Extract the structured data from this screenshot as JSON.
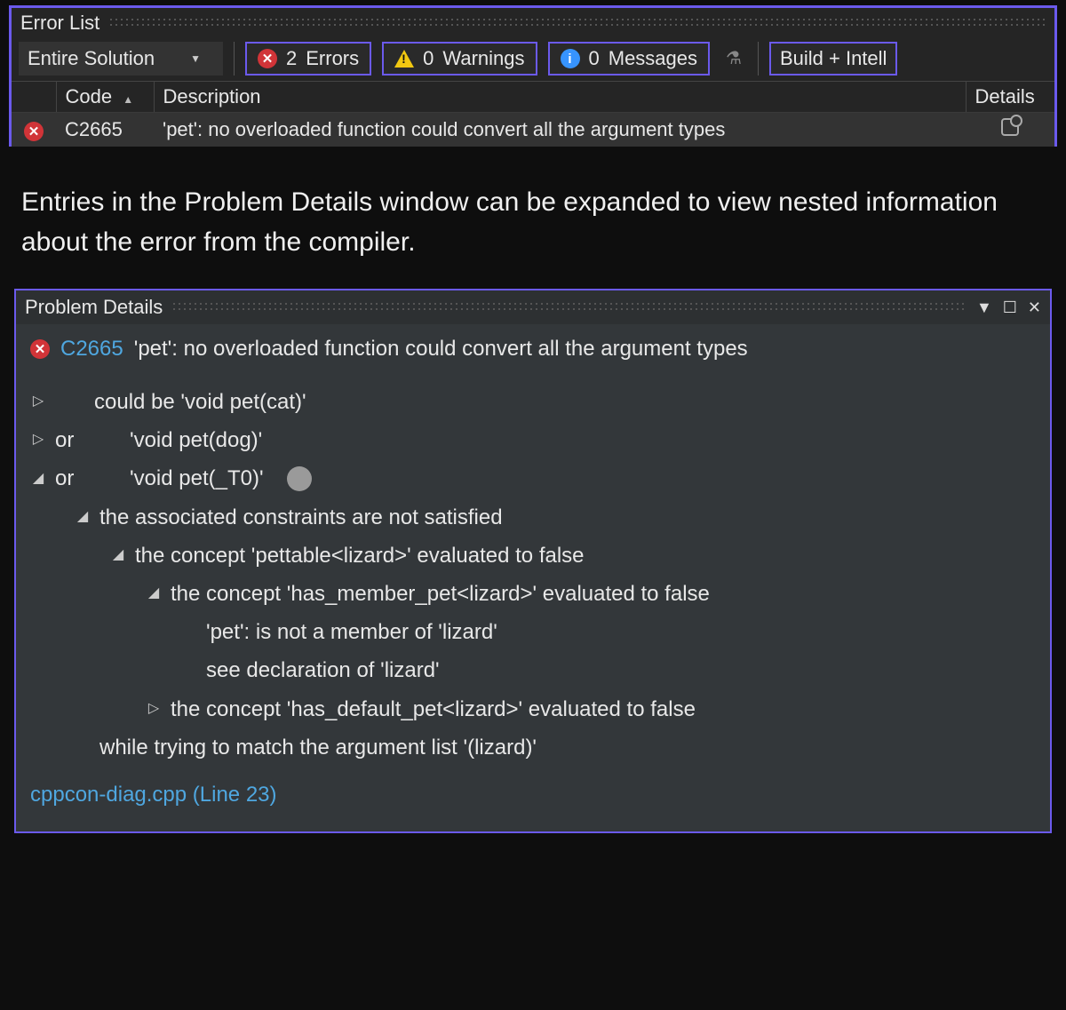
{
  "error_list": {
    "title": "Error List",
    "scope": "Entire Solution",
    "filters": {
      "errors": {
        "count": 2,
        "label": "Errors"
      },
      "warnings": {
        "count": 0,
        "label": "Warnings"
      },
      "messages": {
        "count": 0,
        "label": "Messages"
      }
    },
    "source_label": "Build + Intell",
    "columns": {
      "code": "Code",
      "description": "Description",
      "details": "Details"
    },
    "rows": [
      {
        "type": "error",
        "code": "C2665",
        "description": "'pet': no overloaded function could convert all the argument types"
      }
    ]
  },
  "caption": "Entries in the Problem Details window can be expanded to view nested information about the error from the compiler.",
  "problem_details": {
    "title": "Problem Details",
    "header": {
      "code": "C2665",
      "message": "'pet': no overloaded function could convert all the argument types"
    },
    "tree": {
      "n1": {
        "arrow": "▷",
        "text": "could be 'void pet(cat)'"
      },
      "n2": {
        "arrow": "▷",
        "conn": "or",
        "text": "'void pet(dog)'"
      },
      "n3": {
        "arrow": "◢",
        "conn": "or",
        "text": "'void pet(_T0)'"
      },
      "n3a": {
        "arrow": "◢",
        "text": "the associated constraints are not satisfied"
      },
      "n3a1": {
        "arrow": "◢",
        "text": "the concept 'pettable<lizard>' evaluated to false"
      },
      "n3a1a": {
        "arrow": "◢",
        "text": "the concept 'has_member_pet<lizard>' evaluated to false"
      },
      "n3a1a1": {
        "text": "'pet': is not a member of 'lizard'"
      },
      "n3a1a2": {
        "text": "see declaration of 'lizard'"
      },
      "n3a1b": {
        "arrow": "▷",
        "text": "the concept 'has_default_pet<lizard>' evaluated to false"
      },
      "n4": {
        "text": "while trying to match the argument list '(lizard)'"
      }
    },
    "file_link": "cppcon-diag.cpp (Line 23)"
  }
}
